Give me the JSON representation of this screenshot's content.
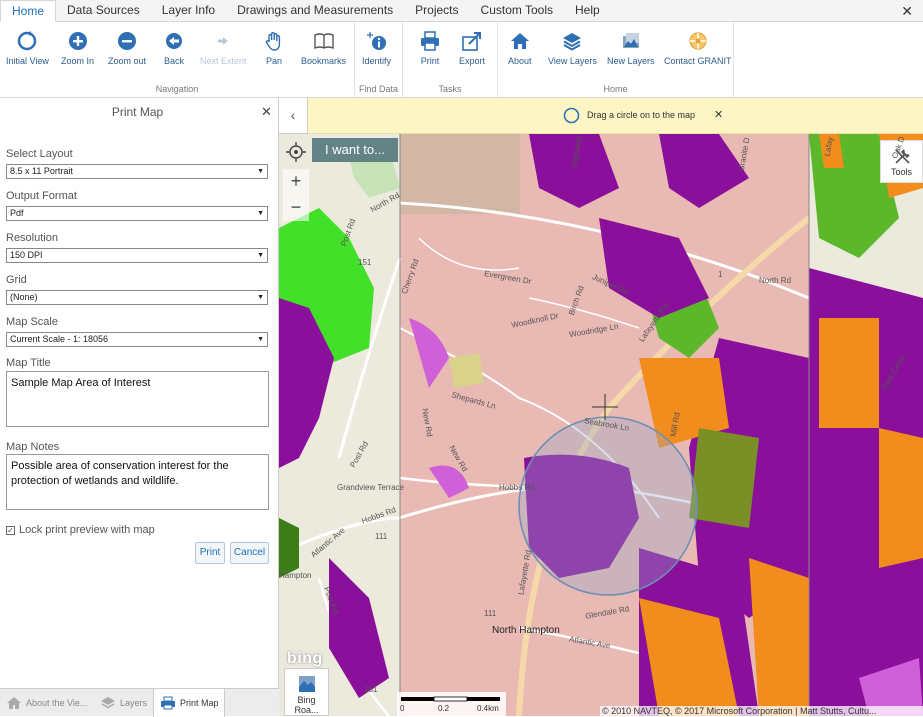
{
  "menu": {
    "tabs": [
      "Home",
      "Data Sources",
      "Layer Info",
      "Drawings and Measurements",
      "Projects",
      "Custom Tools",
      "Help"
    ],
    "active": "Home"
  },
  "ribbon": {
    "navigation": {
      "label": "Navigation",
      "buttons": {
        "initial_view": "Initial View",
        "zoom_in": "Zoom In",
        "zoom_out": "Zoom out",
        "back": "Back",
        "next_extent": "Next Extent",
        "pan": "Pan",
        "bookmarks": "Bookmarks"
      }
    },
    "find_data": {
      "label": "Find Data",
      "identify": "Identify"
    },
    "tasks": {
      "label": "Tasks",
      "print": "Print",
      "export": "Export"
    },
    "home": {
      "label": "Home",
      "about": "About",
      "view_layers": "View Layers",
      "new_layers": "New Layers",
      "contact": "Contact GRANIT"
    }
  },
  "print_panel": {
    "title": "Print Map",
    "layout_label": "Select Layout",
    "layout_value": "8.5 x 11 Portrait",
    "format_label": "Output Format",
    "format_value": "Pdf",
    "resolution_label": "Resolution",
    "resolution_value": "150 DPI",
    "grid_label": "Grid",
    "grid_value": "(None)",
    "scale_label": "Map Scale",
    "scale_value": "Current Scale - 1: 18056",
    "map_title_label": "Map Title",
    "map_title_value": "Sample Map Area of Interest",
    "map_notes_label": "Map Notes",
    "map_notes_value": "Possible area of conservation interest for the protection of wetlands and wildlife.",
    "lock_label": "Lock print preview with map",
    "lock_checked": true,
    "print_button": "Print",
    "cancel_button": "Cancel"
  },
  "bottom_tabs": {
    "about": "About the Vie...",
    "layers": "Layers",
    "print_map": "Print Map"
  },
  "map": {
    "hint": "Drag a circle on to the map",
    "i_want_to": "I want to...",
    "tools": "Tools",
    "basemap": "Bing Roa...",
    "bing_logo": "bing",
    "attribution": "© 2010 NAVTEQ, © 2017 Microsoft Corporation | Matt Stutts, Cultu...",
    "scale_ticks": [
      "0",
      "0.2",
      "0.4km"
    ],
    "labels": {
      "north_hampton": "North Hampton",
      "hampton": "Hampton",
      "evergreen": "Evergreen Dr",
      "woodknoll": "Woodknoll Dr",
      "woodridge": "Woodridge Ln",
      "juniper": "Juniper Rd",
      "birch": "Birch Rd",
      "lafayette_n": "Lafayette Rd",
      "lafayette_s": "Lafayette Rd",
      "hobbs_e": "Hobbs Rd",
      "hobbs_w": "Hobbs Rd",
      "atlantic_e": "Atlantic Ave",
      "atlantic_w": "Atlantic Ave",
      "grandview": "Grandview Terrace",
      "post_n": "Post Rd",
      "post_m": "Post Rd",
      "post_s": "Post Rd",
      "new_rd_n": "New Rd",
      "new_rd_s": "New Rd",
      "north_rd": "North Rd",
      "north_rd_e": "North Rd",
      "cherry": "Cherry Rd",
      "shepards": "Shepards Ln",
      "seabrook": "Seabrook Ln",
      "glendale": "Glendale Rd",
      "park_circle": "Park Circle",
      "highland": "Highland",
      "granite": "Granite D",
      "oak": "Oak D",
      "lafay": "Lafay",
      "mill": "Mill Rd",
      "rt1": "1",
      "rt111_n": "151",
      "rt111_m": "111",
      "rt111_s": "111",
      "rt151": "151"
    }
  },
  "colors": {
    "accent": "#1e6fb8",
    "wetland_purple": "#8a0f9a",
    "light_purple": "#d060d8",
    "orange": "#f28c1c",
    "green": "#5cb82a",
    "bright_green": "#43e02a",
    "olive": "#7a8f25",
    "pink_overlay": "#e9b9b4",
    "hint_bg": "#fdf6c4"
  }
}
